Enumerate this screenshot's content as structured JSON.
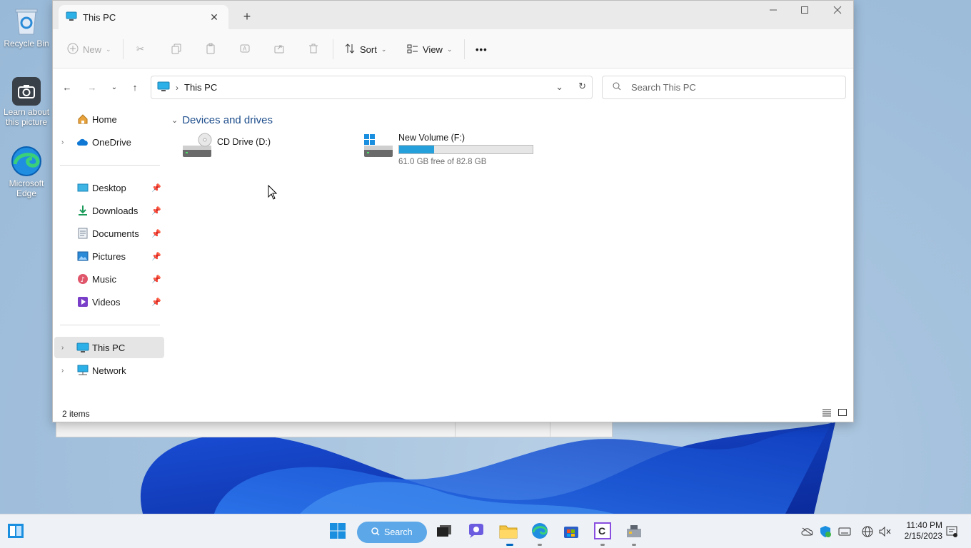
{
  "desktop": {
    "icons": [
      {
        "label": "Recycle Bin"
      },
      {
        "label": "Learn about this picture"
      },
      {
        "label": "Microsoft Edge"
      }
    ]
  },
  "window": {
    "tab_title": "This PC",
    "new_tab_symbol": "+",
    "close_tab_symbol": "✕"
  },
  "commandbar": {
    "new_label": "New",
    "sort_label": "Sort",
    "view_label": "View",
    "more_label": "•••"
  },
  "address": {
    "path_label": "This PC",
    "search_placeholder": "Search This PC"
  },
  "navpane": {
    "home": "Home",
    "onedrive": "OneDrive",
    "desktop": "Desktop",
    "downloads": "Downloads",
    "documents": "Documents",
    "pictures": "Pictures",
    "music": "Music",
    "videos": "Videos",
    "this_pc": "This PC",
    "network": "Network"
  },
  "content": {
    "group_header": "Devices and drives",
    "drives": [
      {
        "name": "CD Drive (D:)"
      },
      {
        "name": "New Volume (F:)",
        "free_text": "61.0 GB free of 82.8 GB",
        "used_fraction": 0.263
      }
    ]
  },
  "statusbar": {
    "item_count": "2 items"
  },
  "taskbar": {
    "search_label": "Search",
    "time": "11:40 PM",
    "date": "2/15/2023"
  },
  "colors": {
    "accent": "#0067c0",
    "progress": "#26a0da",
    "selected_bg": "#e5e5e5"
  }
}
